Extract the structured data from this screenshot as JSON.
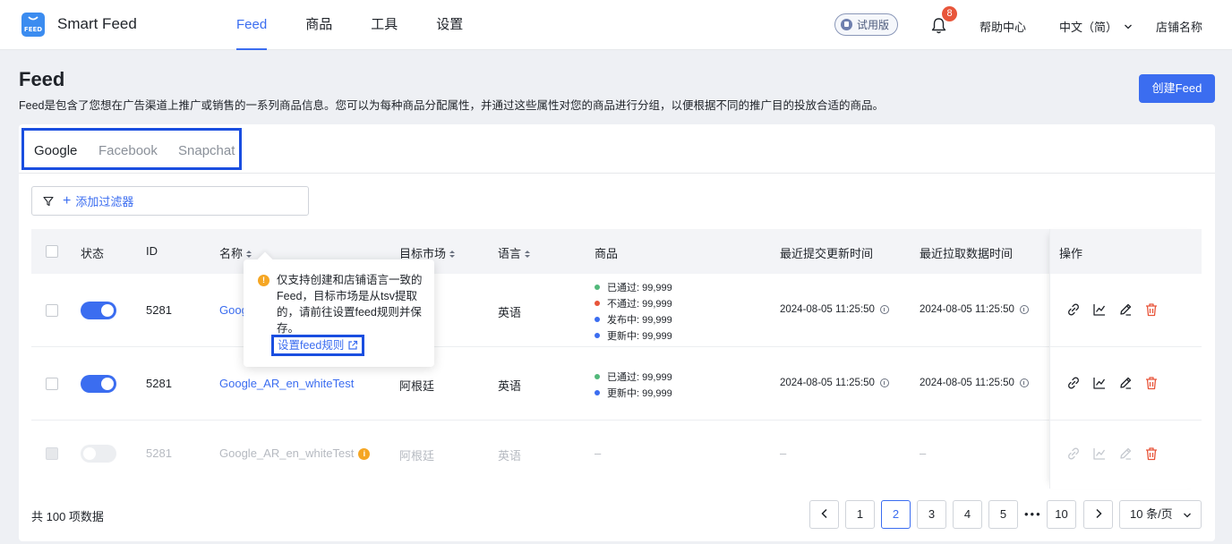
{
  "header": {
    "logo_text": "FEED",
    "app_name": "Smart Feed",
    "nav": [
      {
        "label": "Feed",
        "active": true
      },
      {
        "label": "商品",
        "active": false
      },
      {
        "label": "工具",
        "active": false
      },
      {
        "label": "设置",
        "active": false
      }
    ],
    "trial_label": "试用版",
    "notification_count": "8",
    "help_label": "帮助中心",
    "language_label": "中文（简）",
    "store_name": "店铺名称"
  },
  "page": {
    "title": "Feed",
    "description": "Feed是包含了您想在广告渠道上推广或销售的一系列商品信息。您可以为每种商品分配属性，并通过这些属性对您的商品进行分组，以便根据不同的推广目的投放合适的商品。",
    "create_button": "创建Feed"
  },
  "tabs": [
    {
      "label": "Google",
      "active": true
    },
    {
      "label": "Facebook",
      "active": false
    },
    {
      "label": "Snapchat",
      "active": false
    }
  ],
  "filter": {
    "label": "添加过滤器"
  },
  "table": {
    "columns": {
      "status": "状态",
      "id": "ID",
      "name": "名称",
      "market": "目标市场",
      "language": "语言",
      "products": "商品",
      "last_submit": "最近提交更新时间",
      "last_fetch": "最近拉取数据时间",
      "actions": "操作"
    },
    "rows": [
      {
        "id": "5281",
        "name": "Google_AR_en_whiteTest",
        "name_visible": "Goog",
        "market": "",
        "language": "英语",
        "stats": [
          {
            "label": "已通过: 99,999",
            "color": "#52b87a"
          },
          {
            "label": "不通过: 99,999",
            "color": "#e8553a"
          },
          {
            "label": "发布中: 99,999",
            "color": "#3b6df0"
          },
          {
            "label": "更新中: 99,999",
            "color": "#3b6df0"
          }
        ],
        "last_submit": "2024-08-05 11:25:50",
        "last_fetch": "2024-08-05 11:25:50",
        "enabled": true
      },
      {
        "id": "5281",
        "name": "Google_AR_en_whiteTest",
        "market": "阿根廷",
        "language": "英语",
        "stats": [
          {
            "label": "已通过: 99,999",
            "color": "#52b87a"
          },
          {
            "label": "更新中: 99,999",
            "color": "#3b6df0"
          }
        ],
        "last_submit": "2024-08-05 11:25:50",
        "last_fetch": "2024-08-05 11:25:50",
        "enabled": true
      },
      {
        "id": "5281",
        "name": "Google_AR_en_whiteTest",
        "market": "阿根廷",
        "language": "英语",
        "products": "–",
        "last_submit": "–",
        "last_fetch": "–",
        "enabled": false
      }
    ]
  },
  "tooltip": {
    "text": "仅支持创建和店铺语言一致的Feed，目标市场是从tsv提取的，请前往设置feed规则并保存。",
    "link": "设置feed规则"
  },
  "footer": {
    "total": "共 100 项数据",
    "pages": [
      "1",
      "2",
      "3",
      "4",
      "5",
      "10"
    ],
    "current_page": "2",
    "ellipsis": "•••",
    "page_size": "10 条/页"
  }
}
